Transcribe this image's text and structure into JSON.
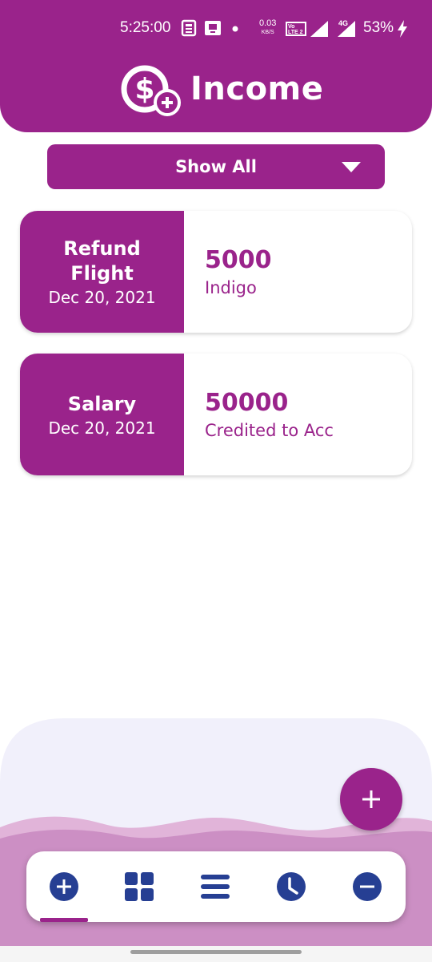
{
  "status_bar": {
    "time": "5:25:00",
    "network_speed_top": "0.03",
    "network_speed_unit": "KB/S",
    "volte_label": "Vo LTE 2",
    "network_type": "4G",
    "battery": "53%"
  },
  "header": {
    "title": "Income",
    "icon": "dollar-plus-icon"
  },
  "filter": {
    "label": "Show All",
    "icon": "caret-down-icon"
  },
  "entries": [
    {
      "category": "Refund Flight",
      "date": "Dec 20, 2021",
      "amount": "5000",
      "description": "Indigo"
    },
    {
      "category": "Salary",
      "date": "Dec 20, 2021",
      "amount": "50000",
      "description": "Credited to Acc"
    }
  ],
  "fab": {
    "icon": "plus-icon"
  },
  "bottom_nav": {
    "items": [
      {
        "name": "income",
        "icon": "plus-circle-icon",
        "active": true
      },
      {
        "name": "dashboard",
        "icon": "grid-icon",
        "active": false
      },
      {
        "name": "list",
        "icon": "menu-icon",
        "active": false
      },
      {
        "name": "history",
        "icon": "clock-icon",
        "active": false
      },
      {
        "name": "expense",
        "icon": "minus-circle-icon",
        "active": false
      }
    ]
  },
  "colors": {
    "primary": "#9a238b",
    "nav_icon": "#263f93",
    "wave_light": "#f1f0fb",
    "wave_mid": "#e1b4d9",
    "wave_dark": "#cc8fc4"
  }
}
